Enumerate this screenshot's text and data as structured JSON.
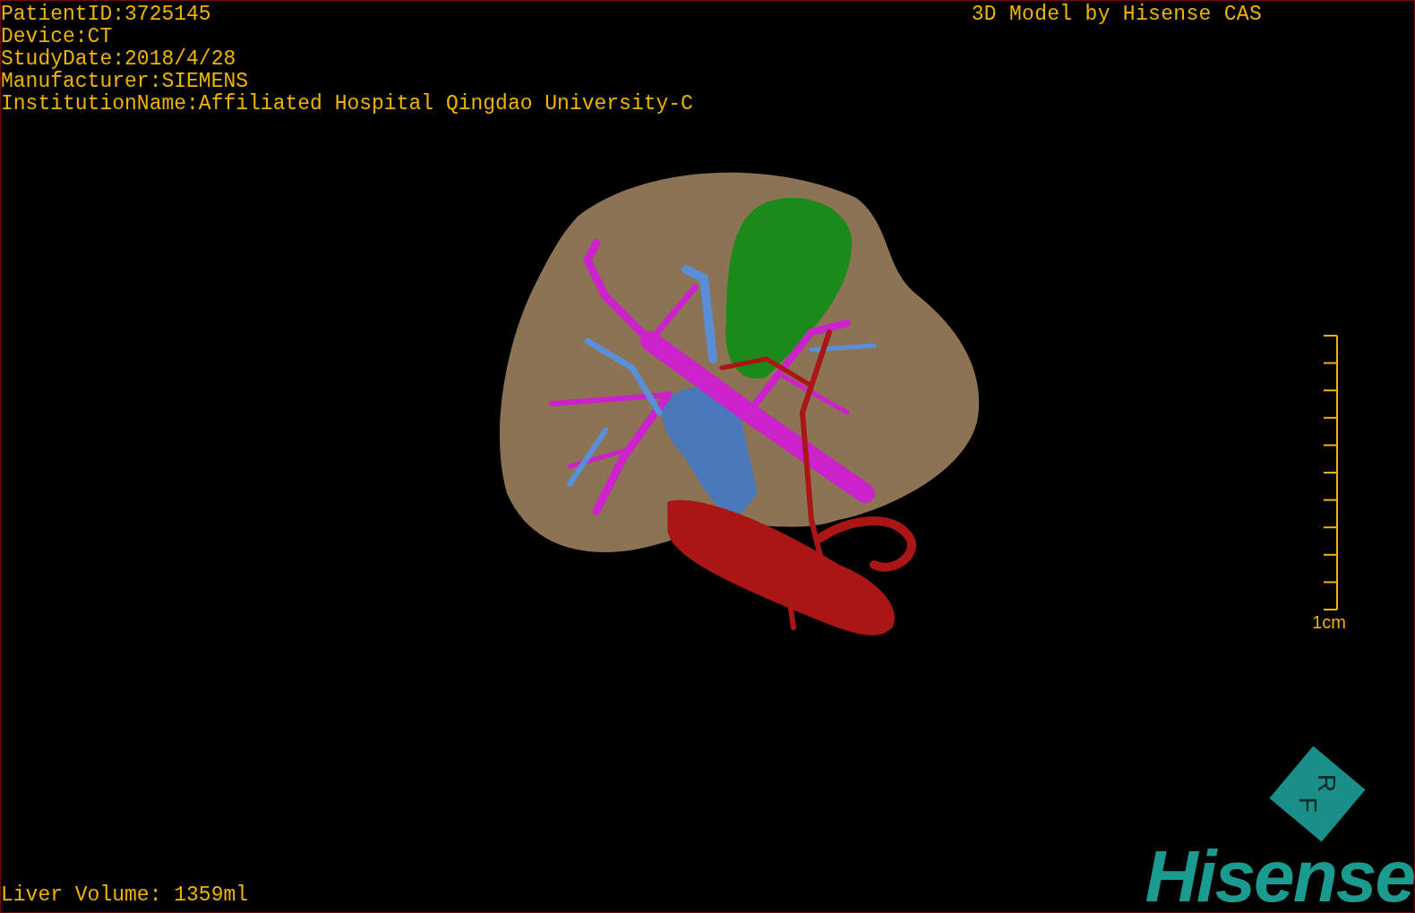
{
  "info_lines": [
    "PatientID:3725145",
    "Device:CT",
    "StudyDate:2018/4/28",
    "Manufacturer:SIEMENS",
    "InstitutionName:Affiliated Hospital Qingdao University-C"
  ],
  "title": "3D Model by Hisense CAS",
  "scale_bar": {
    "label": "1cm"
  },
  "liver_volume": "Liver Volume: 1359ml",
  "orientation_cube": {
    "letters": [
      "R",
      "F"
    ]
  },
  "logo": "Hisense"
}
